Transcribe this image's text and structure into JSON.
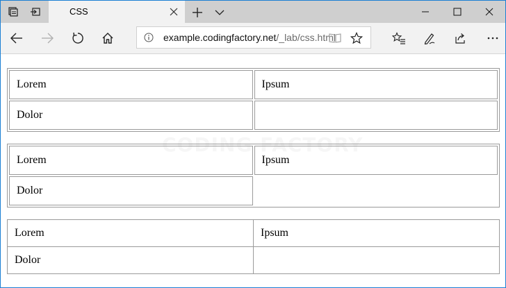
{
  "browser": {
    "tab_title": "CSS",
    "url_host": "example.codingfactory.net",
    "url_path": "/_lab/css.html",
    "accent_color": "#1a7fd4"
  },
  "icons": {
    "tab_actions": [
      "set-tabs-aside-icon",
      "show-aside-tabs-icon"
    ],
    "nav": [
      "back-icon",
      "forward-icon",
      "refresh-icon",
      "home-icon"
    ],
    "address": [
      "info-icon",
      "reading-view-icon",
      "favorite-star-icon"
    ],
    "tools": [
      "favorites-list-icon",
      "notes-pen-icon",
      "share-icon",
      "more-icon"
    ],
    "window": [
      "minimize-icon",
      "maximize-icon",
      "close-icon"
    ]
  },
  "page": {
    "watermark": "CODING FACTORY",
    "table1": {
      "rows": [
        [
          "Lorem",
          "Ipsum"
        ],
        [
          "Dolor",
          ""
        ]
      ]
    },
    "table2": {
      "rows": [
        [
          "Lorem",
          "Ipsum"
        ],
        [
          "Dolor",
          ""
        ]
      ]
    },
    "table3": {
      "rows": [
        [
          "Lorem",
          "Ipsum"
        ],
        [
          "Dolor",
          ""
        ]
      ]
    }
  }
}
